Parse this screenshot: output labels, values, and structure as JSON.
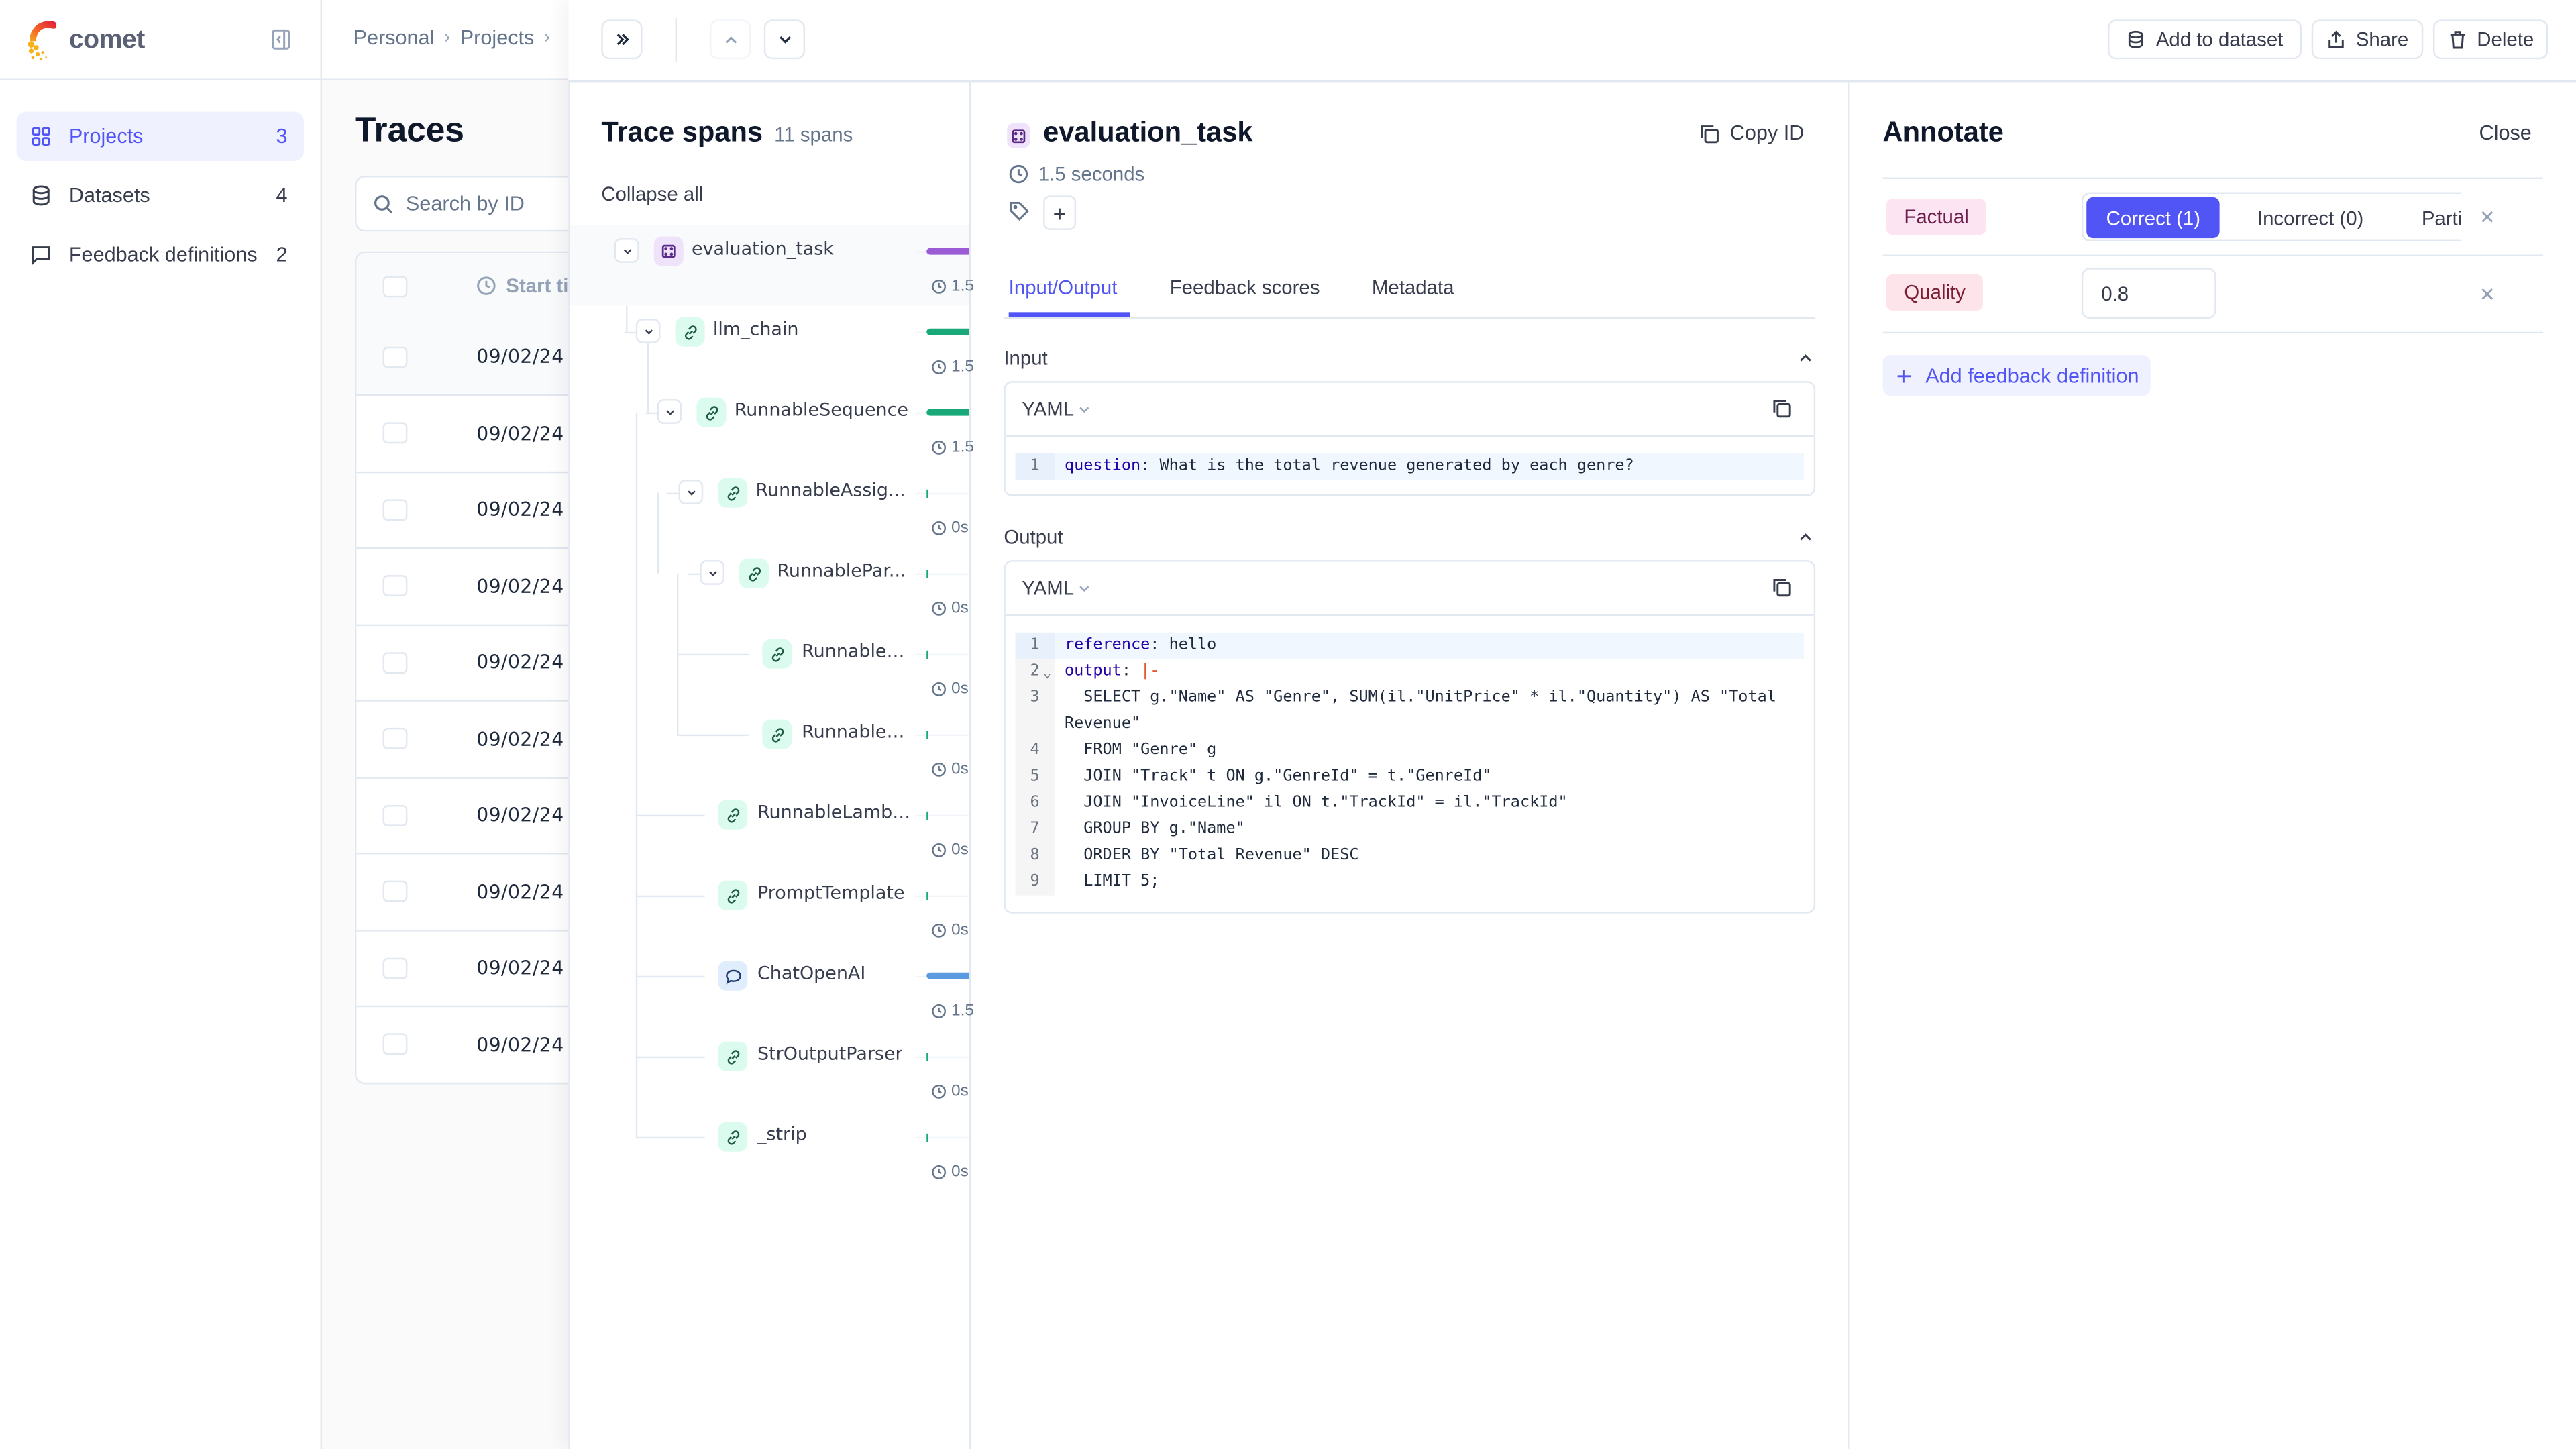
{
  "app": {
    "name": "comet"
  },
  "sidebar": {
    "items": [
      {
        "label": "Projects",
        "count": "3",
        "icon": "grid-icon",
        "active": true
      },
      {
        "label": "Datasets",
        "count": "4",
        "icon": "database-icon",
        "active": false
      },
      {
        "label": "Feedback definitions",
        "count": "2",
        "icon": "message-square-icon",
        "active": false
      }
    ]
  },
  "breadcrumb": {
    "items": [
      "Personal",
      "Projects"
    ]
  },
  "traces_page": {
    "title": "Traces",
    "search_placeholder": "Search by ID",
    "table": {
      "columns": [
        "Start ti"
      ],
      "rows": [
        "09/02/24 (",
        "09/02/24 (",
        "09/02/24 (",
        "09/02/24 (",
        "09/02/24 (",
        "09/02/24 (",
        "09/02/24 (",
        "09/02/24 (",
        "09/02/24 (",
        "09/02/24 ("
      ]
    }
  },
  "drawer_header": {
    "add_to_dataset": "Add to dataset",
    "share": "Share",
    "delete": "Delete"
  },
  "trace_spans": {
    "title": "Trace spans",
    "count": "11 spans",
    "collapse_all": "Collapse all",
    "spans": [
      {
        "name": "evaluation_task",
        "type": "general",
        "duration": "1.5",
        "expandable": true,
        "depth": 0,
        "bar_fraction": 1.0
      },
      {
        "name": "llm_chain",
        "type": "chain",
        "duration": "1.5",
        "expandable": true,
        "depth": 1,
        "bar_fraction": 1.0
      },
      {
        "name": "RunnableSequence",
        "type": "chain",
        "duration": "1.5",
        "expandable": true,
        "depth": 2,
        "bar_fraction": 1.0
      },
      {
        "name": "RunnableAssig...",
        "type": "chain",
        "duration": "0s",
        "expandable": true,
        "depth": 3,
        "bar_fraction": 0.0
      },
      {
        "name": "RunnablePar...",
        "type": "chain",
        "duration": "0s",
        "expandable": true,
        "depth": 4,
        "bar_fraction": 0.0
      },
      {
        "name": "RunnableL...",
        "type": "chain",
        "duration": "0s",
        "expandable": false,
        "depth": 5,
        "bar_fraction": 0.0
      },
      {
        "name": "RunnableL...",
        "type": "chain",
        "duration": "0s",
        "expandable": false,
        "depth": 5,
        "bar_fraction": 0.0
      },
      {
        "name": "RunnableLambda",
        "type": "chain",
        "duration": "0s",
        "expandable": false,
        "depth": 3,
        "bar_fraction": 0.0
      },
      {
        "name": "PromptTemplate",
        "type": "chain",
        "duration": "0s",
        "expandable": false,
        "depth": 3,
        "bar_fraction": 0.0
      },
      {
        "name": "ChatOpenAI",
        "type": "llm",
        "duration": "1.5",
        "expandable": false,
        "depth": 3,
        "bar_fraction": 1.0
      },
      {
        "name": "StrOutputParser",
        "type": "chain",
        "duration": "0s",
        "expandable": false,
        "depth": 3,
        "bar_fraction": 0.0
      },
      {
        "name": "_strip",
        "type": "chain",
        "duration": "0s",
        "expandable": false,
        "depth": 3,
        "bar_fraction": 0.0
      }
    ],
    "colors": {
      "general": "#9B5BD4",
      "chain": "#19A979",
      "llm": "#5B9BE0"
    }
  },
  "detail": {
    "title": "evaluation_task",
    "copy_id": "Copy ID",
    "duration": "1.5 seconds",
    "tabs": [
      "Input/Output",
      "Feedback scores",
      "Metadata"
    ],
    "active_tab": "Input/Output",
    "input": {
      "label": "Input",
      "format": "YAML",
      "lines": [
        {
          "n": "1",
          "key": "question",
          "sep": ": ",
          "value": "What is the total revenue generated by each genre?"
        }
      ]
    },
    "output": {
      "label": "Output",
      "format": "YAML",
      "lines": [
        {
          "n": "1",
          "key": "reference",
          "sep": ": ",
          "value": "hello"
        },
        {
          "n": "2",
          "key": "output",
          "sep": ": ",
          "op": "|-",
          "value": ""
        },
        {
          "n": "3",
          "key": "",
          "sep": "",
          "value": "  SELECT g.\"Name\" AS \"Genre\", SUM(il.\"UnitPrice\" * il.\"Quantity\") AS \"Total Revenue\""
        },
        {
          "n": "4",
          "key": "",
          "sep": "",
          "value": "  FROM \"Genre\" g"
        },
        {
          "n": "5",
          "key": "",
          "sep": "",
          "value": "  JOIN \"Track\" t ON g.\"GenreId\" = t.\"GenreId\""
        },
        {
          "n": "6",
          "key": "",
          "sep": "",
          "value": "  JOIN \"InvoiceLine\" il ON t.\"TrackId\" = il.\"TrackId\""
        },
        {
          "n": "7",
          "key": "",
          "sep": "",
          "value": "  GROUP BY g.\"Name\""
        },
        {
          "n": "8",
          "key": "",
          "sep": "",
          "value": "  ORDER BY \"Total Revenue\" DESC"
        },
        {
          "n": "9",
          "key": "",
          "sep": "",
          "value": "  LIMIT 5;"
        }
      ]
    }
  },
  "annotate": {
    "title": "Annotate",
    "close": "Close",
    "rows": [
      {
        "name": "Factual",
        "options": [
          "Correct (1)",
          "Incorrect (0)",
          "Parti"
        ],
        "selected": "Correct (1)"
      },
      {
        "name": "Quality",
        "value": "0.8"
      }
    ],
    "add_feedback_definition": "Add feedback definition"
  },
  "colors": {
    "accent": "#5155F5",
    "accent_bg": "#F0F1FE",
    "border": "#E2E8F0"
  }
}
